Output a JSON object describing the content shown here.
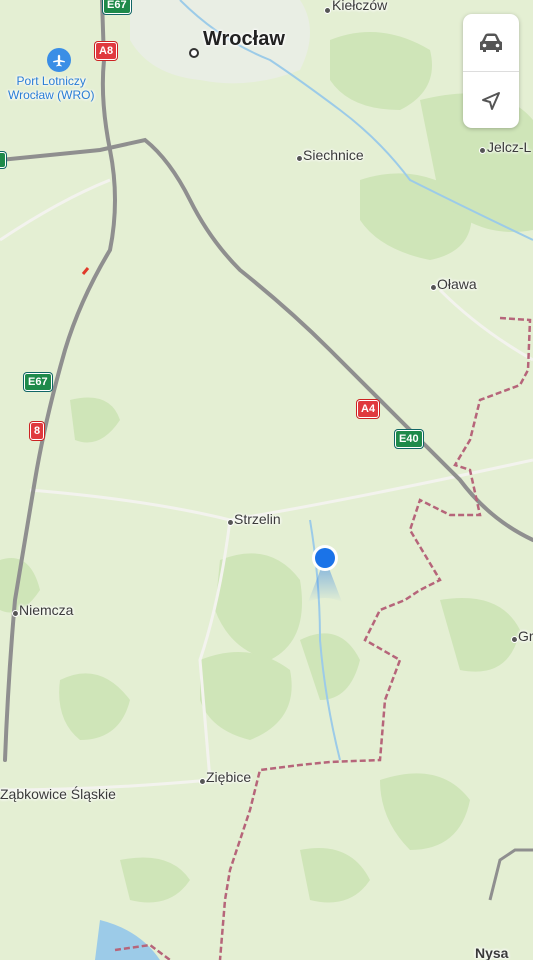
{
  "map": {
    "places": {
      "wroclaw": "Wrocław",
      "kielczow": "Kiełczów",
      "siechnice": "Siechnice",
      "jelcz": "Jelcz-L",
      "olawa": "Oława",
      "strzelin": "Strzelin",
      "niemcza": "Niemcza",
      "ziebice": "Ziębice",
      "zabkowice": "Ząbkowice Śląskie",
      "nysa": "Nysa",
      "gr_partial": "Gr"
    },
    "airport": {
      "line1": "Port Lotniczy",
      "line2": "Wrocław (WRO)"
    },
    "shields": {
      "e67_top": "E67",
      "a8": "A8",
      "e67": "E67",
      "road8": "8",
      "a4": "A4",
      "e40": "E40"
    },
    "colors": {
      "land": "#e4efd3",
      "forest": "#c9e2b3",
      "motorway": "#8a8a8a",
      "border": "#b6657a",
      "water": "#9ccbe8",
      "user_location": "#1a73e8"
    },
    "icons": {
      "transport_mode": "car-icon",
      "recenter": "location-arrow-icon",
      "airport": "airplane-icon"
    }
  }
}
